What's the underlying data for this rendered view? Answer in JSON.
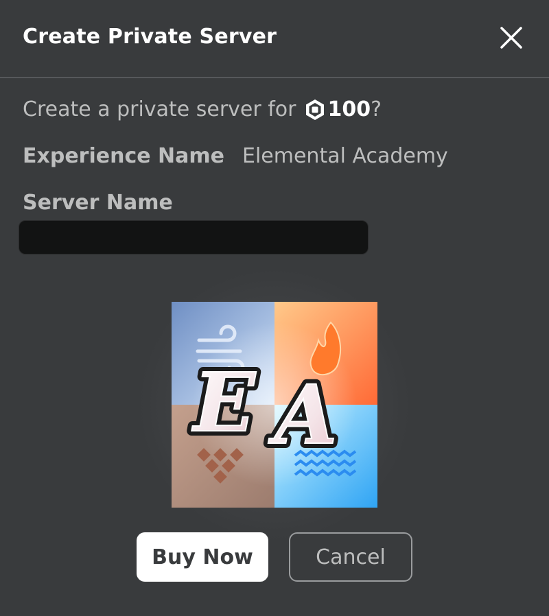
{
  "dialog": {
    "title": "Create Private Server",
    "close_icon": "close-icon"
  },
  "prompt": {
    "text": "Create a private server for",
    "currency_icon": "robux-icon",
    "price": "100",
    "suffix": "?"
  },
  "experience": {
    "label": "Experience Name",
    "value": "Elemental Academy"
  },
  "server": {
    "label": "Server Name",
    "value": "",
    "placeholder": ""
  },
  "thumbnail": {
    "icon": "experience-thumbnail",
    "lettering": "EA",
    "quadrant_colors": [
      "#8fb0dc",
      "#ff9a5c",
      "#c9a48e",
      "#7fd4f5"
    ]
  },
  "actions": {
    "buy_label": "Buy Now",
    "cancel_label": "Cancel"
  }
}
